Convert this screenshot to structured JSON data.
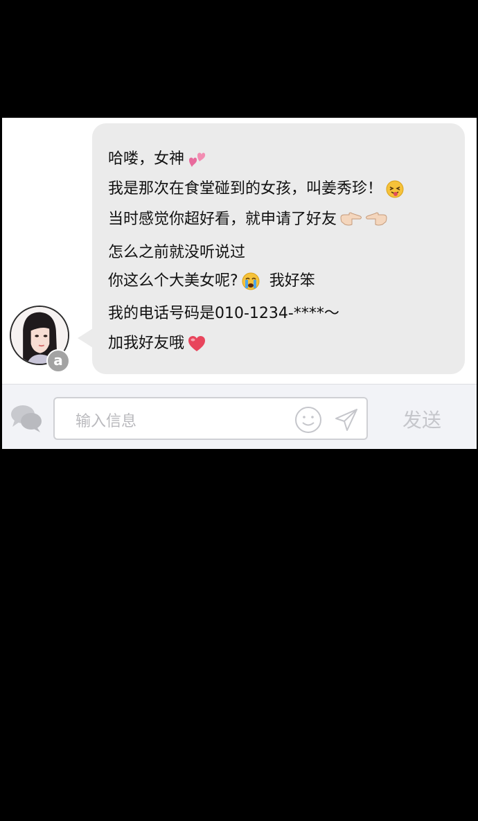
{
  "chat": {
    "messages": [
      "哈喽，女神",
      "我是那次在食堂碰到的女孩，叫姜秀珍！",
      "当时感觉你超好看，就申请了好友",
      "怎么之前就没听说过",
      "你这么个大美女呢?",
      "我的电话号码是010-1234-****～",
      "加我好友哦"
    ],
    "extra_text": "我好笨",
    "avatar_badge": "a"
  },
  "input": {
    "placeholder": "输入信息",
    "send_label": "发送"
  },
  "icons": {
    "line1": "two-hearts-icon",
    "line2": "tongue-wink-face-icon",
    "line3": "pointing-hands-icon",
    "line5": "crying-face-icon",
    "line7": "heart-icon",
    "chat": "chat-bubbles-icon",
    "smile": "smile-icon",
    "send": "send-arrow-icon"
  },
  "colors": {
    "bubble": "#ebebeb",
    "input_bar": "#f2f3f7",
    "send_label": "#c5c6cb",
    "heart": "#e8455c"
  }
}
